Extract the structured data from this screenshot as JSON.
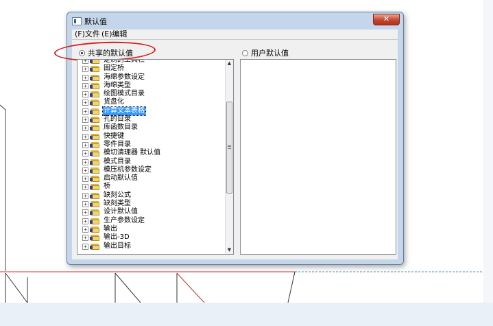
{
  "window": {
    "title": "默认值",
    "close_symbol": "✕"
  },
  "menu": [
    {
      "label": "(F)文件"
    },
    {
      "label": "(E)编辑"
    }
  ],
  "options": {
    "shared_label": "共享的默认值",
    "shared_checked": true,
    "user_label": "用户默认值",
    "user_checked": false
  },
  "tree": {
    "expander_symbol": "+",
    "items": [
      {
        "label": "定制的工具栏"
      },
      {
        "label": "固定桥"
      },
      {
        "label": "海绵参数设定"
      },
      {
        "label": "海绵类型"
      },
      {
        "label": "绘图模式目录"
      },
      {
        "label": "货盘化"
      },
      {
        "label": "计算文本表格",
        "selected": true
      },
      {
        "label": "孔的目录"
      },
      {
        "label": "库函数目录"
      },
      {
        "label": "快捷键"
      },
      {
        "label": "零件目录"
      },
      {
        "label": "模切清理器 默认值"
      },
      {
        "label": "模式目录"
      },
      {
        "label": "模压机参数设定"
      },
      {
        "label": "启动默认值"
      },
      {
        "label": "桥"
      },
      {
        "label": "缺刻公式"
      },
      {
        "label": "缺刻类型"
      },
      {
        "label": "设计默认值"
      },
      {
        "label": "生产参数设定"
      },
      {
        "label": "输出"
      },
      {
        "label": "输出-3D"
      },
      {
        "label": "输出目标"
      }
    ]
  },
  "scrollbar": {
    "up_symbol": "▲",
    "down_symbol": "▼"
  },
  "colors": {
    "highlight": "#d42020",
    "selection": "#3399ff",
    "dialog_frame": "#c5d6ea"
  }
}
